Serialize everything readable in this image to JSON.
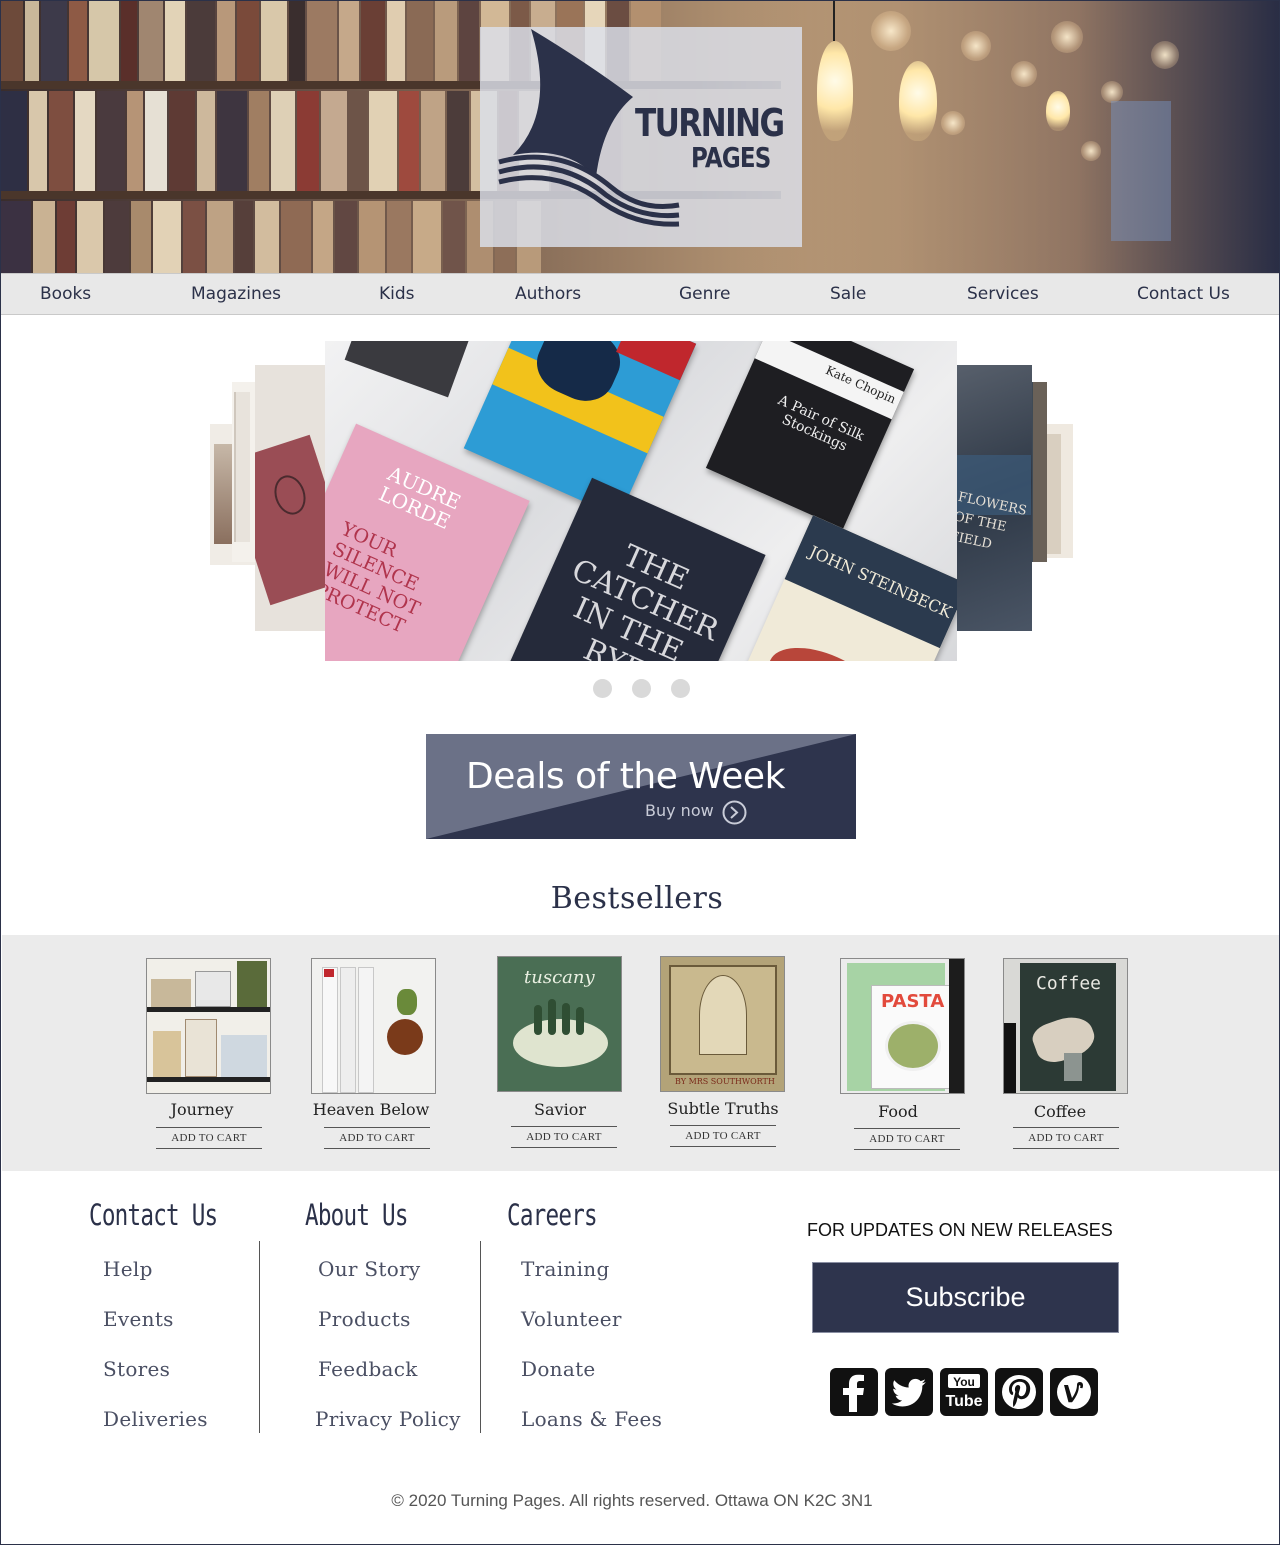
{
  "brand": {
    "logo_line1": "TURNING",
    "logo_line2": "PAGES",
    "primary_color": "#2b3149",
    "accent_gray": "#ebebeb"
  },
  "nav": {
    "items": [
      "Books",
      "Magazines",
      "Kids",
      "Authors",
      "Genre",
      "Sale",
      "Services",
      "Contact Us"
    ]
  },
  "carousel": {
    "dots": 3,
    "cover_texts": {
      "audre": "AUDRE LORDE",
      "silence": "YOUR SILENCE WILL NOT PROTECT",
      "catcher": "THE CATCHER IN THE RYE",
      "chopin": "Kate Chopin",
      "silk": "A Pair of Silk Stockings",
      "steinbeck": "JOHN STEINBECK",
      "flowers": "FLOWERS OF THE FIELD"
    }
  },
  "deals": {
    "title": "Deals of the Week",
    "cta": "Buy now",
    "light_color": "#6b7187",
    "dark_color": "#2e344d"
  },
  "bestsellers": {
    "title": "Bestsellers",
    "add_label": "ADD TO CART",
    "products": [
      {
        "name": "Journey"
      },
      {
        "name": "Heaven Below"
      },
      {
        "name": "Savior",
        "cover_text": "tuscany"
      },
      {
        "name": "Subtle Truths",
        "cover_text": "BY MRS SOUTHWORTH"
      },
      {
        "name": "Food",
        "cover_text": "PASTA"
      },
      {
        "name": "Coffee",
        "cover_text": "Coffee"
      }
    ]
  },
  "footer": {
    "columns": [
      {
        "heading": "Contact Us",
        "links": [
          "Help",
          "Events",
          "Stores",
          "Deliveries"
        ]
      },
      {
        "heading": "About Us",
        "links": [
          "Our Story",
          "Products",
          "Feedback",
          "Privacy Policy"
        ]
      },
      {
        "heading": "Careers",
        "links": [
          "Training",
          "Volunteer",
          "Donate",
          "Loans & Fees"
        ]
      }
    ],
    "updates_label": "FOR UPDATES ON NEW RELEASES",
    "subscribe_label": "Subscribe",
    "social_icons": [
      "facebook-icon",
      "twitter-icon",
      "youtube-icon",
      "pinterest-icon",
      "vine-icon"
    ],
    "youtube_text_1": "You",
    "youtube_text_2": "Tube",
    "copyright": "© 2020 Turning Pages. All rights reserved. Ottawa ON K2C 3N1"
  }
}
